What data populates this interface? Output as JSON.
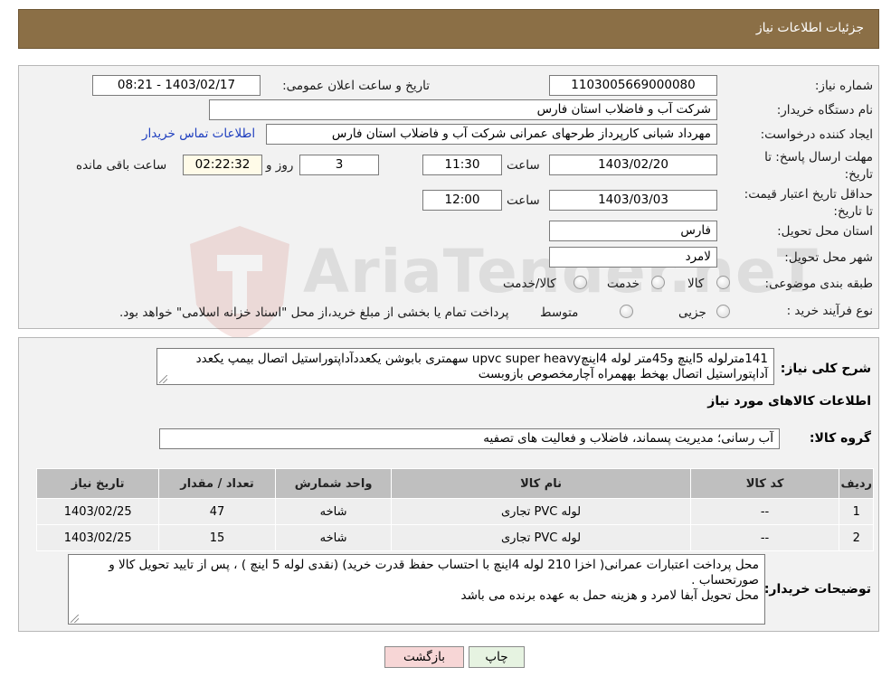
{
  "header": {
    "title": "جزئیات اطلاعات نیاز"
  },
  "form": {
    "need_number_label": "شماره نیاز:",
    "need_number": "1103005669000080",
    "announce_label": "تاریخ و ساعت اعلان عمومی:",
    "announce_value": "1403/02/17 - 08:21",
    "buyer_org_label": "نام دستگاه خریدار:",
    "buyer_org": "شرکت آب و فاضلاب استان فارس",
    "creator_label": "ایجاد کننده درخواست:",
    "creator": "مهرداد شبانی کارپرداز طرحهای عمرانی  شرکت آب و فاضلاب استان فارس",
    "contact_link": "اطلاعات تماس خریدار",
    "deadline_label": "مهلت ارسال پاسخ: تا تاریخ:",
    "deadline_date": "1403/02/20",
    "time_label": "ساعت",
    "deadline_time": "11:30",
    "days_count": "3",
    "days_label": "روز و",
    "remaining_time": "02:22:32",
    "remaining_label": "ساعت باقی مانده",
    "validity_label": "حداقل تاریخ اعتبار قیمت: تا تاریخ:",
    "validity_date": "1403/03/03",
    "validity_time": "12:00",
    "province_label": "استان محل تحویل:",
    "province": "فارس",
    "city_label": "شهر محل تحویل:",
    "city": "لامرد",
    "category_label": "طبقه بندی موضوعی:",
    "category_options": [
      "کالا",
      "خدمت",
      "کالا/خدمت"
    ],
    "process_label": "نوع فرآیند خرید :",
    "process_options": [
      "جزیی",
      "متوسط"
    ],
    "process_note": "پرداخت تمام یا بخشی از مبلغ خرید،از محل \"اسناد خزانه اسلامی\" خواهد بود."
  },
  "summary": {
    "label": "شرح کلی نیاز:",
    "text": "141مترلوله 5اینچ و45متر لوله 4اینچupvc super heavy سهمتری بابوشن یکعددآداپتوراستیل اتصال بیمپ یکعدد آداپتوراستیل اتصال بهخط بههمراه آچارمخصوص بازوبست"
  },
  "goods": {
    "section_title": "اطلاعات کالاهای مورد نیاز",
    "group_label": "گروه کالا:",
    "group_value": "آب رسانی؛ مدیریت پسماند، فاضلاب و فعالیت های تصفیه",
    "columns": [
      "ردیف",
      "کد کالا",
      "نام کالا",
      "واحد شمارش",
      "تعداد / مقدار",
      "تاریخ نیاز"
    ],
    "rows": [
      [
        "1",
        "--",
        "لوله PVC تجاری",
        "شاخه",
        "47",
        "1403/02/25"
      ],
      [
        "2",
        "--",
        "لوله PVC تجاری",
        "شاخه",
        "15",
        "1403/02/25"
      ]
    ]
  },
  "buyer_notes": {
    "label": "توضیحات خریدار:",
    "line1": "محل پرداخت اعتبارات عمرانی( اخزا 210 لوله 4اینچ با احتساب حفظ قدرت خرید) (نقدی لوله 5 اینچ ) ، پس از تایید تحویل کالا و صورتحساب .",
    "line2": "محل تحویل  آبفا لامرد و هزینه حمل به عهده برنده می باشد"
  },
  "buttons": {
    "print": "چاپ",
    "back": "بازگشت"
  },
  "watermark": {
    "text": "AriaTender.neT"
  },
  "colors": {
    "header_bg": "#8b6f46",
    "link": "#1f3fbf",
    "back_button_bg": "#f7d6d6",
    "print_button_bg": "#e6f3e1"
  }
}
